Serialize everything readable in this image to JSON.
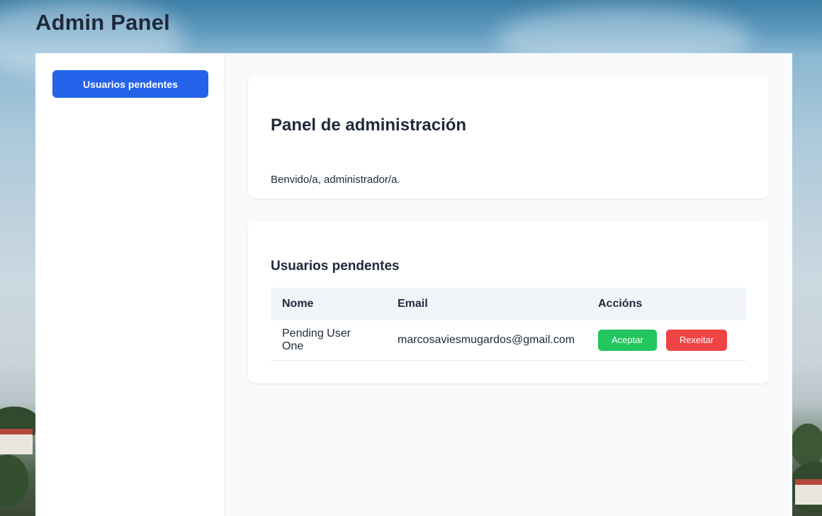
{
  "header": {
    "title": "Admin Panel"
  },
  "sidebar": {
    "items": [
      {
        "label": "Usuarios pendentes",
        "active": true
      }
    ]
  },
  "welcome": {
    "heading": "Panel de administración",
    "message": "Benvido/a, administrador/a."
  },
  "pending_users": {
    "heading": "Usuarios pendentes",
    "columns": [
      "Nome",
      "Email",
      "Accións"
    ],
    "rows": [
      {
        "name": "Pending User One",
        "email": "marcosaviesmugardos@gmail.com",
        "accept_label": "Aceptar",
        "reject_label": "Rexeitar"
      }
    ]
  },
  "colors": {
    "primary": "#2563eb",
    "accept": "#22c55e",
    "reject": "#ef4444",
    "heading": "#1e293b"
  }
}
